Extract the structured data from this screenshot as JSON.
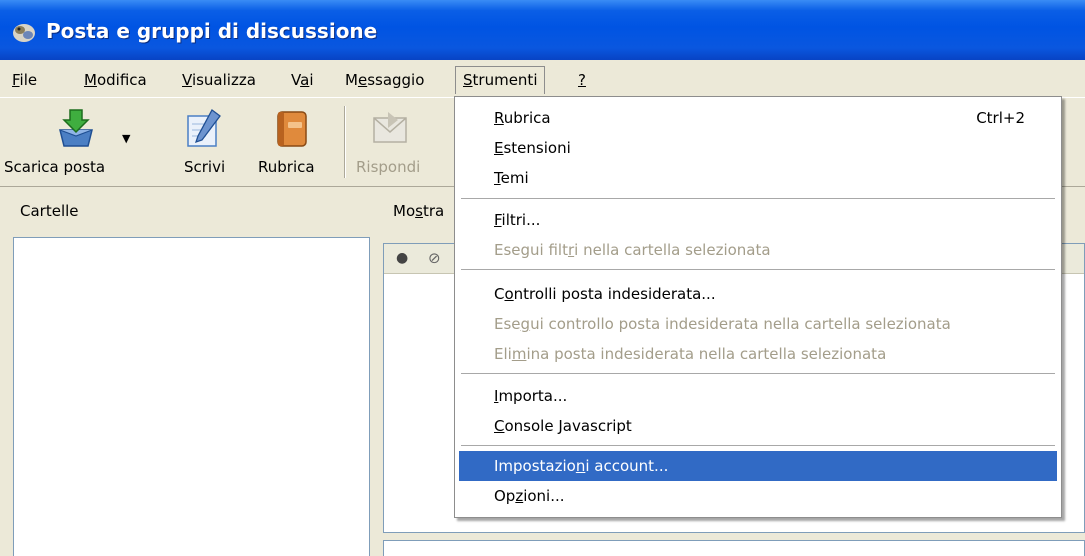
{
  "window": {
    "title": "Posta e gruppi di discussione"
  },
  "menubar": {
    "items": [
      {
        "label": "File",
        "key": "F",
        "rest": "ile"
      },
      {
        "label": "Modifica",
        "key": "M",
        "rest": "odifica"
      },
      {
        "label": "Visualizza",
        "key": "V",
        "rest": "isualizza"
      },
      {
        "label": "Vai",
        "pre": "V",
        "key": "a",
        "rest": "i"
      },
      {
        "label": "Messaggio",
        "pre": "M",
        "key": "e",
        "rest": "ssaggio"
      },
      {
        "label": "Strumenti",
        "key": "S",
        "rest": "trumenti"
      },
      {
        "label": "?",
        "key": "?"
      }
    ]
  },
  "toolbar": {
    "scarica_label": "Scarica posta",
    "scrivi_label": "Scrivi",
    "rubrica_label": "Rubrica",
    "rispondi_label": "Rispondi"
  },
  "folders": {
    "header": "Cartelle"
  },
  "view": {
    "label_pre": "Mo",
    "label_key": "s",
    "label_rest": "tra"
  },
  "strumenti_menu": {
    "rubrica": {
      "key": "R",
      "rest": "ubrica",
      "shortcut": "Ctrl+2"
    },
    "estensioni": {
      "key": "E",
      "rest": "stensioni"
    },
    "temi": {
      "key": "T",
      "rest": "emi"
    },
    "filtri": {
      "key": "F",
      "rest": "iltri..."
    },
    "esegui_filtri": {
      "pre": "Esegui filt",
      "key": "r",
      "rest": "i nella cartella selezionata"
    },
    "controlli_posta": {
      "pre": "C",
      "key": "o",
      "rest": "ntrolli posta indesiderata..."
    },
    "esegui_controllo": {
      "pre": "Ese",
      "key": "g",
      "rest": "ui controllo posta indesiderata nella cartella selezionata"
    },
    "elimina_posta": {
      "pre": "Eli",
      "key": "m",
      "rest": "ina posta indesiderata nella cartella selezionata"
    },
    "importa": {
      "key": "I",
      "rest": "mporta..."
    },
    "console": {
      "key": "C",
      "rest": "onsole Javascript"
    },
    "impostazioni": {
      "pre": "Impostazio",
      "key": "n",
      "rest": "i account..."
    },
    "opzioni": {
      "pre": "Op",
      "key": "z",
      "rest": "ioni..."
    }
  }
}
